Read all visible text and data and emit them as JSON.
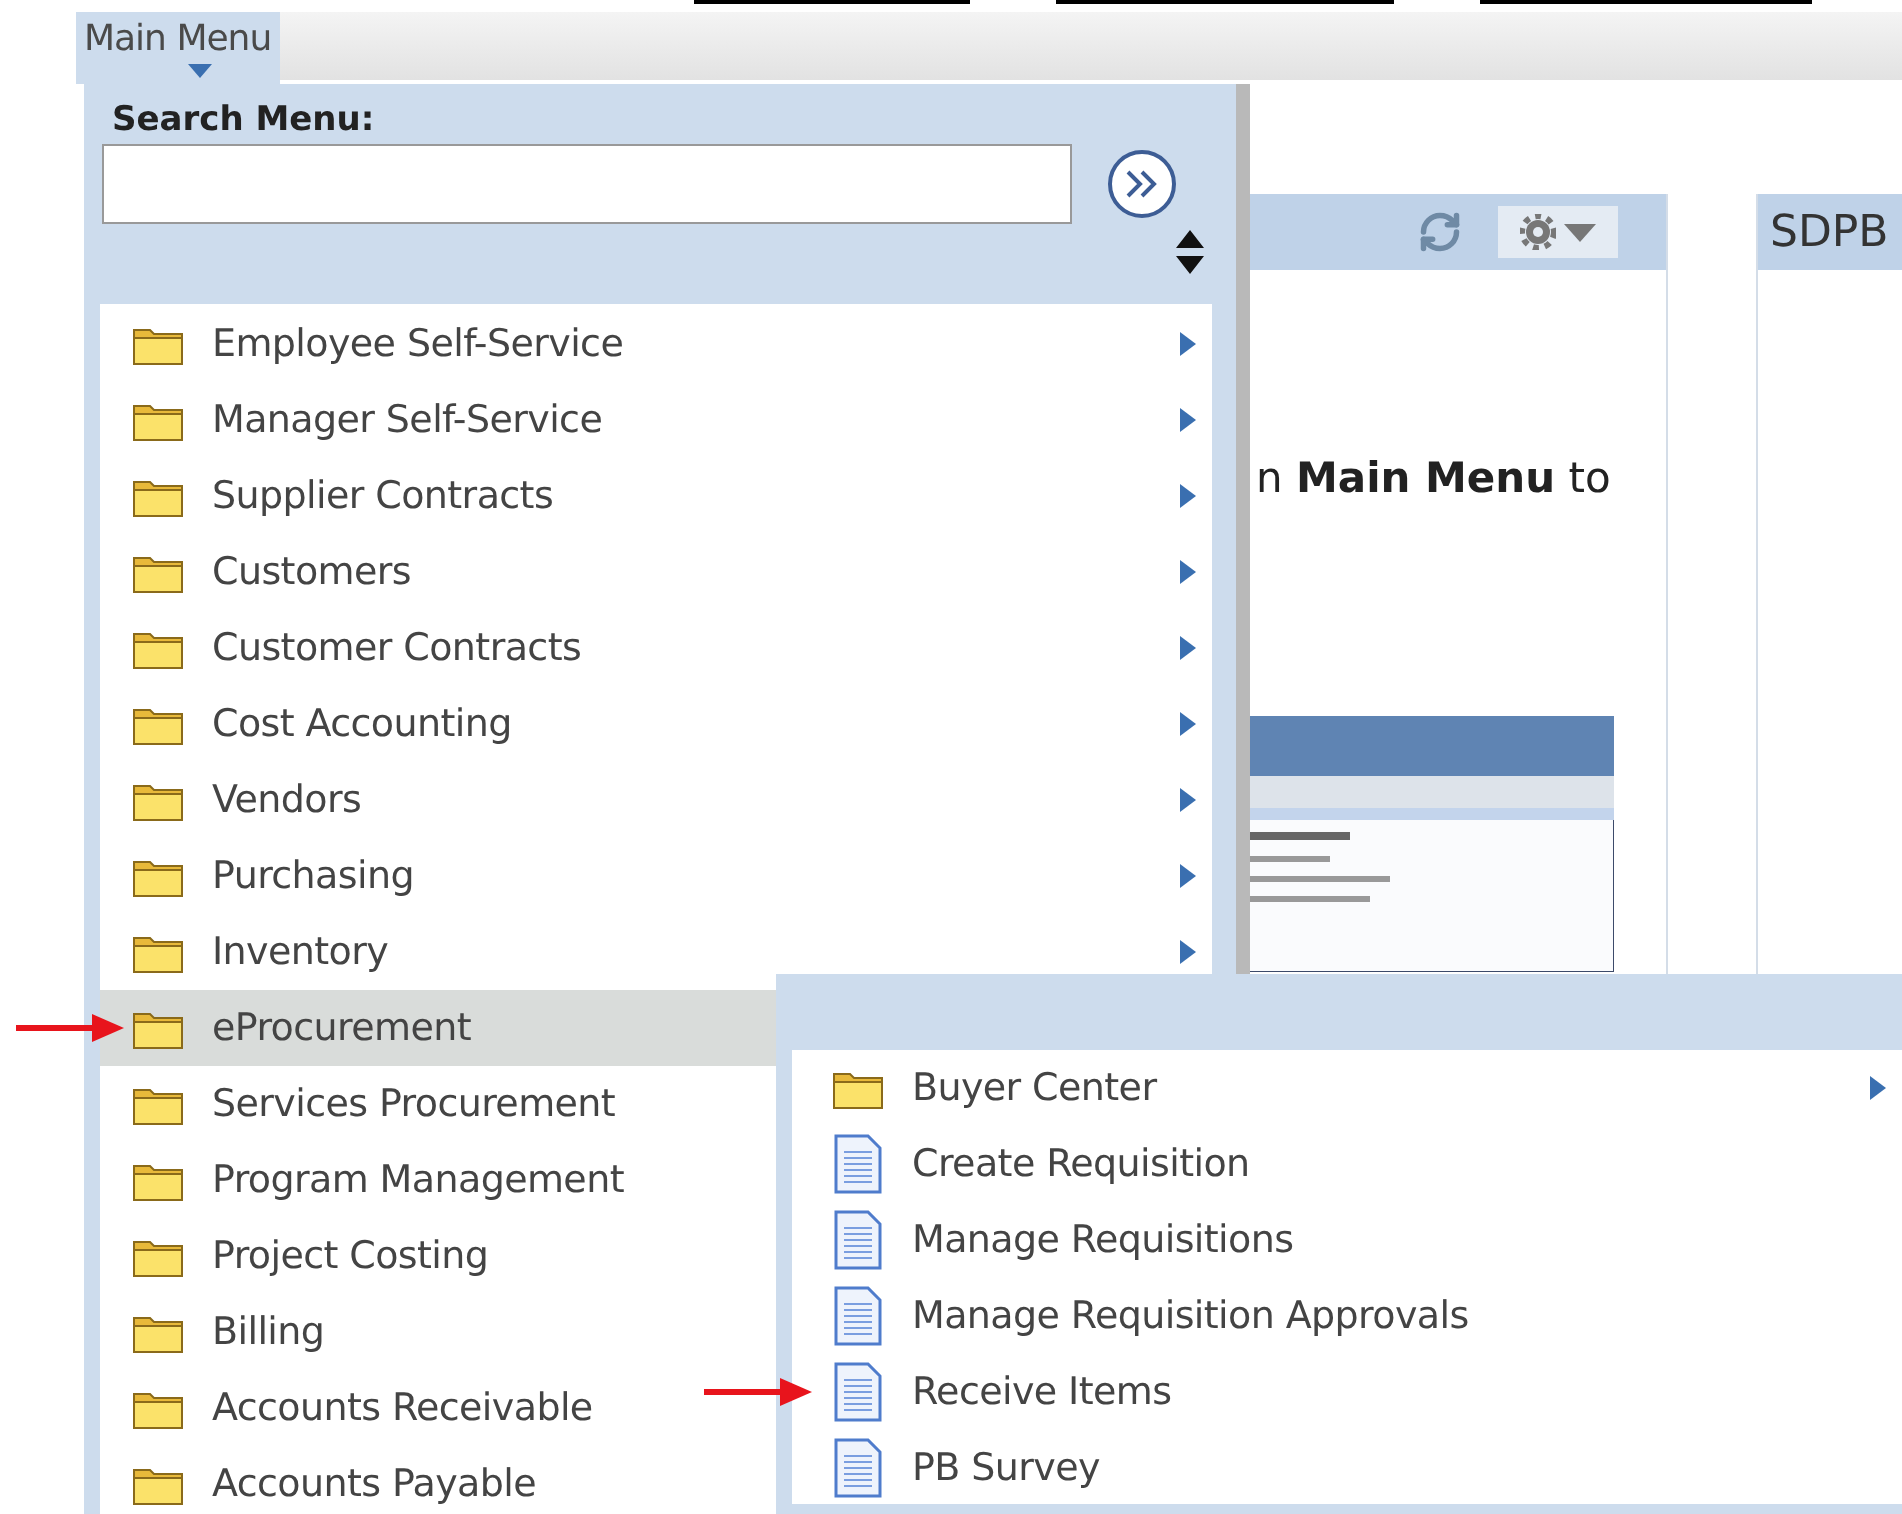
{
  "top_bar": {
    "menu_label": "Main Menu"
  },
  "pagelets": [
    {
      "body_text": "n **Main Menu** to",
      "has_picture": true,
      "has_toolbar": true
    },
    {
      "title": "SDPB",
      "has_picture": false,
      "has_toolbar": false
    }
  ],
  "main_menu": {
    "search_label": "Search Menu:",
    "items": [
      {
        "label": "Employee Self-Service",
        "kind": "folder",
        "submenu_arrow": true,
        "selected": false,
        "pointed": false
      },
      {
        "label": "Manager Self-Service",
        "kind": "folder",
        "submenu_arrow": true,
        "selected": false,
        "pointed": false
      },
      {
        "label": "Supplier Contracts",
        "kind": "folder",
        "submenu_arrow": true,
        "selected": false,
        "pointed": false
      },
      {
        "label": "Customers",
        "kind": "folder",
        "submenu_arrow": true,
        "selected": false,
        "pointed": false
      },
      {
        "label": "Customer Contracts",
        "kind": "folder",
        "submenu_arrow": true,
        "selected": false,
        "pointed": false
      },
      {
        "label": "Cost Accounting",
        "kind": "folder",
        "submenu_arrow": true,
        "selected": false,
        "pointed": false
      },
      {
        "label": "Vendors",
        "kind": "folder",
        "submenu_arrow": true,
        "selected": false,
        "pointed": false
      },
      {
        "label": "Purchasing",
        "kind": "folder",
        "submenu_arrow": true,
        "selected": false,
        "pointed": false
      },
      {
        "label": "Inventory",
        "kind": "folder",
        "submenu_arrow": true,
        "selected": false,
        "pointed": false
      },
      {
        "label": "eProcurement",
        "kind": "folder",
        "selected": true,
        "pointed": true
      },
      {
        "label": "Services Procurement",
        "kind": "folder",
        "selected": false,
        "pointed": false
      },
      {
        "label": "Program Management",
        "kind": "folder",
        "selected": false,
        "pointed": false
      },
      {
        "label": "Project Costing",
        "kind": "folder",
        "selected": false,
        "pointed": false
      },
      {
        "label": "Billing",
        "kind": "folder",
        "selected": false,
        "pointed": false
      },
      {
        "label": "Accounts Receivable",
        "kind": "folder",
        "selected": false,
        "pointed": false
      },
      {
        "label": "Accounts Payable",
        "kind": "folder",
        "selected": false,
        "pointed": false
      }
    ]
  },
  "submenu": {
    "items": [
      {
        "label": "Buyer Center",
        "kind": "folder",
        "submenu_arrow": true,
        "pointed": false
      },
      {
        "label": "Create Requisition",
        "kind": "page",
        "submenu_arrow": false,
        "pointed": false
      },
      {
        "label": "Manage Requisitions",
        "kind": "page",
        "submenu_arrow": false,
        "pointed": false
      },
      {
        "label": "Manage Requisition Approvals",
        "kind": "page",
        "submenu_arrow": false,
        "pointed": false
      },
      {
        "label": "Receive Items",
        "kind": "page",
        "submenu_arrow": false,
        "pointed": true
      },
      {
        "label": "PB Survey",
        "kind": "page",
        "submenu_arrow": false,
        "pointed": false
      }
    ]
  }
}
